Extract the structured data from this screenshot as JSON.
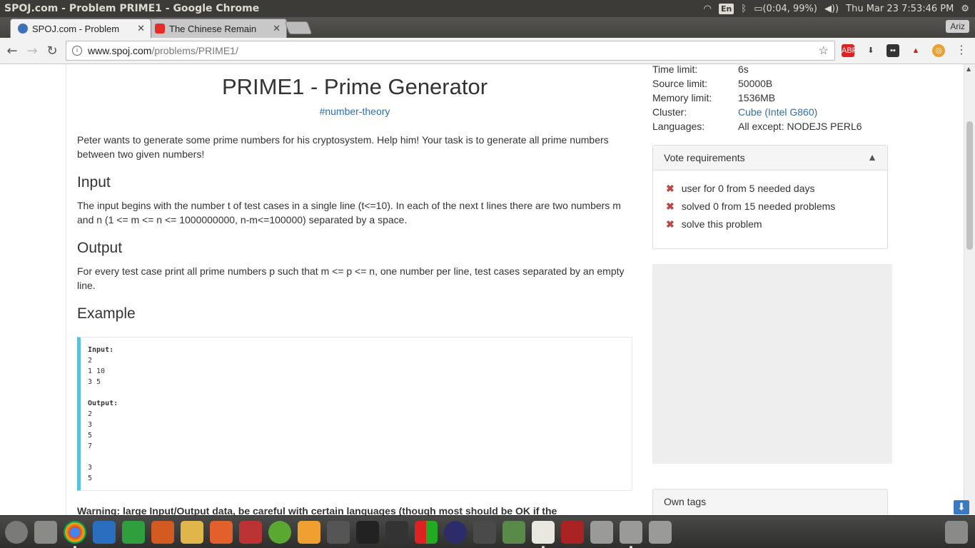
{
  "os": {
    "window_title": "SPOJ.com - Problem PRIME1 - Google Chrome",
    "keyboard": "En",
    "battery": "(0:04, 99%)",
    "clock": "Thu Mar 23  7:53:46 PM"
  },
  "tabs": [
    {
      "label": "SPOJ.com - Problem",
      "active": true
    },
    {
      "label": "The Chinese Remain",
      "active": false
    }
  ],
  "profile": "Ariz",
  "omnibox": {
    "host": "www.spoj.com",
    "path": "/problems/PRIME1/"
  },
  "problem": {
    "title": "PRIME1 - Prime Generator",
    "tag": "#number-theory",
    "intro": "Peter wants to generate some prime numbers for his cryptosystem. Help him! Your task is to generate all prime numbers between two given numbers!",
    "input_heading": "Input",
    "input_text": "The input begins with the number t of test cases in a single line (t<=10). In each of the next t lines there are two numbers m and n (1 <= m <= n <= 1000000000, n-m<=100000) separated by a space.",
    "output_heading": "Output",
    "output_text": "For every test case print all prime numbers p such that m <= p <= n, one number per line, test cases separated by an empty line.",
    "example_heading": "Example",
    "example_input_label": "Input:",
    "example_input": "2\n1 10\n3 5",
    "example_output_label": "Output:",
    "example_output": "2\n3\n5\n7\n\n3\n5",
    "warning": "Warning: large Input/Output data, be careful with certain languages (though most should be OK if the"
  },
  "meta": [
    {
      "label": "Time limit:",
      "value": "6s"
    },
    {
      "label": "Source limit:",
      "value": "50000B"
    },
    {
      "label": "Memory limit:",
      "value": "1536MB"
    },
    {
      "label": "Cluster:",
      "value": "Cube (Intel G860)"
    },
    {
      "label": "Languages:",
      "value": "All except: NODEJS PERL6"
    }
  ],
  "vote": {
    "title": "Vote requirements",
    "items": [
      "user for 0 from 5 needed days",
      "solved 0 from 15 needed problems",
      "solve this problem"
    ]
  },
  "own_tags": "Own tags"
}
